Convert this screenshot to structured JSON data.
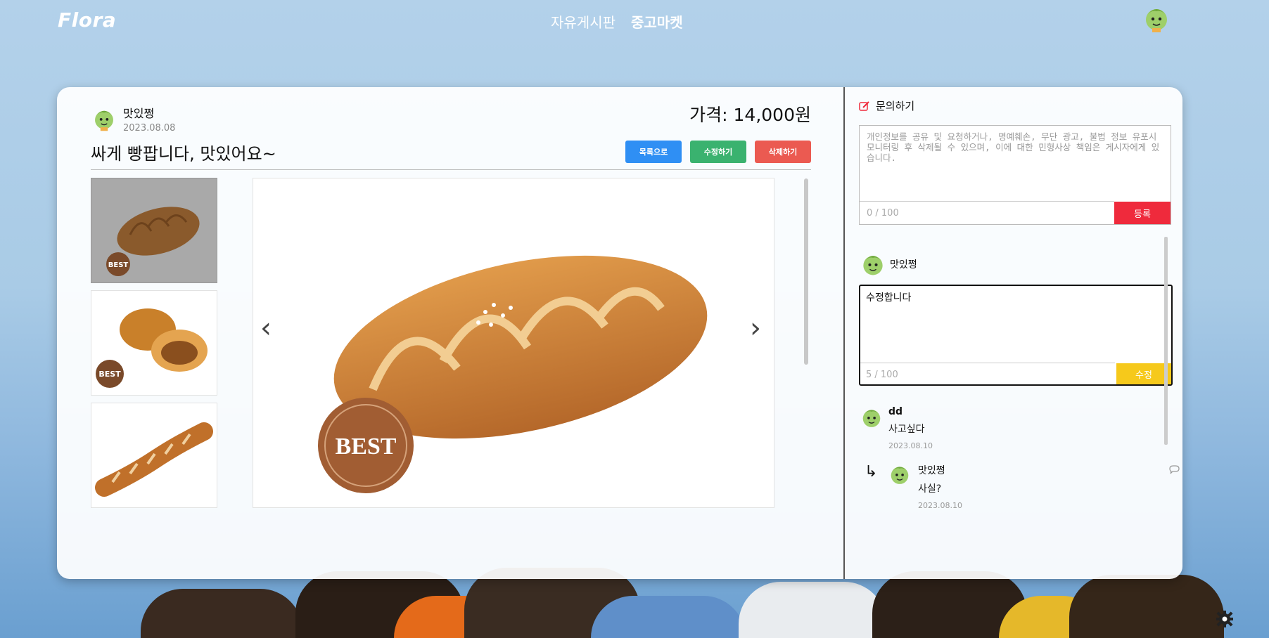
{
  "app": {
    "logo": "Flora"
  },
  "nav": {
    "items": [
      "자유게시판",
      "중고마켓"
    ],
    "active": "중고마켓"
  },
  "post": {
    "author": "맛있쩡",
    "date": "2023.08.08",
    "price": "가격: 14,000원",
    "title": "싸게 빵팝니다, 맛있어요~",
    "buttons": {
      "list": "목록으로",
      "edit": "수정하기",
      "delete": "삭제하기"
    },
    "images": [
      "salt-bread",
      "curry-bread",
      "twisted-bread"
    ],
    "selected_image": 0
  },
  "inquiry": {
    "header": "문의하기",
    "placeholder": "개인정보를 공유 및 요청하거나, 명예훼손, 무단 광고, 불법 정보 유포시 모니터링 후 삭제될 수 있으며, 이에 대한 민형사상 책임은 게시자에게 있습니다.",
    "count": "0 / 100",
    "submit_label": "등록"
  },
  "editing": {
    "author": "맛있쩡",
    "text": "수정합니다",
    "count": "5 / 100",
    "submit_label": "수정"
  },
  "comments": [
    {
      "author": "dd",
      "text": "사고싶다",
      "date": "2023.08.10"
    },
    {
      "author": "맛있쩡",
      "text": "사실?",
      "date": "2023.08.10",
      "reply": true
    }
  ],
  "reply_arrow": "↳",
  "badge_text": "BEST",
  "colors": {
    "accent_red": "#ef2a3c",
    "edit_yellow": "#f6c91b",
    "blue": "#2f8ff4",
    "green": "#3ab26f"
  }
}
